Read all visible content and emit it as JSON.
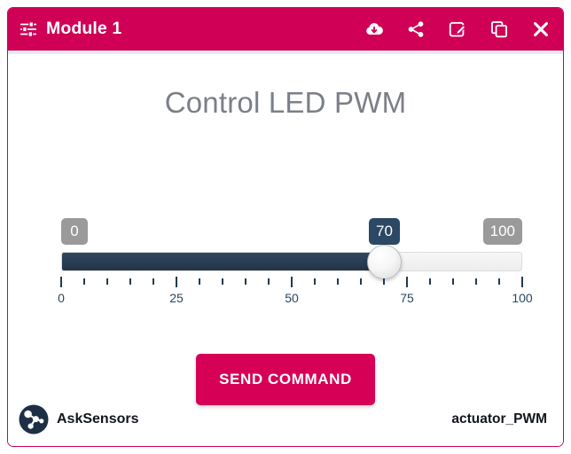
{
  "window": {
    "border_color": "#cf0055"
  },
  "header": {
    "title": "Module 1",
    "background_color": "#cf0055",
    "menu_icon": "sliders-icon",
    "actions": [
      {
        "name": "cloud-download-icon",
        "label": "Download"
      },
      {
        "name": "share-icon",
        "label": "Share"
      },
      {
        "name": "edit-icon",
        "label": "Edit"
      },
      {
        "name": "copy-icon",
        "label": "Duplicate"
      },
      {
        "name": "close-icon",
        "label": "Close"
      }
    ]
  },
  "main": {
    "title": "Control LED PWM",
    "title_color": "#7b7f87",
    "slider": {
      "min": 0,
      "max": 100,
      "value": 70,
      "min_label": "0",
      "max_label": "100",
      "value_label": "70",
      "fill_color": "#2b4865",
      "badge_color": "#9a9a9a",
      "active_badge_color": "#2b4865",
      "tick_step": 5,
      "major_tick_step": 25,
      "tick_labels": [
        "0",
        "25",
        "50",
        "75",
        "100"
      ],
      "tick_label_values": [
        0,
        25,
        50,
        75,
        100
      ]
    },
    "send_button": {
      "label": "SEND COMMAND",
      "color": "#d60056"
    }
  },
  "footer": {
    "brand": "AskSensors",
    "logo_icon": "asksensors-logo-icon",
    "actuator": "actuator_PWM"
  }
}
